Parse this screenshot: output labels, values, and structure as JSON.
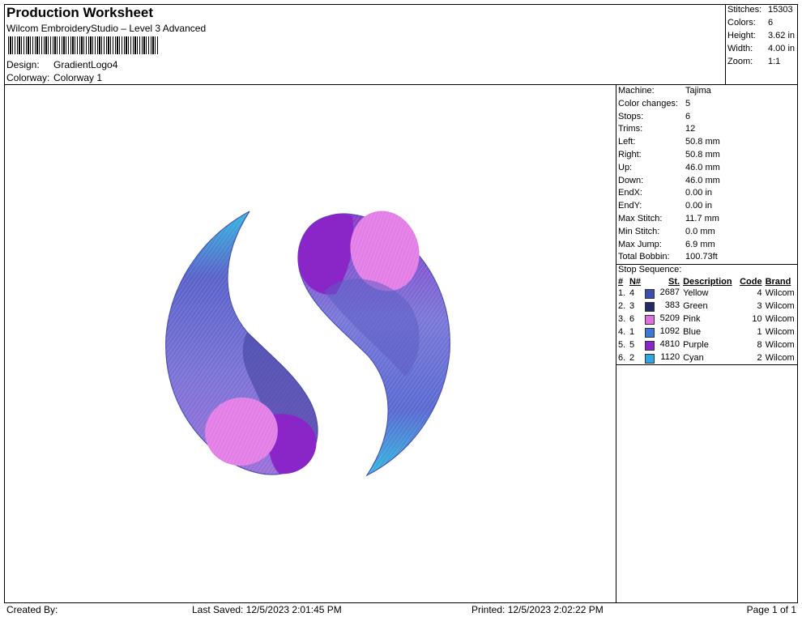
{
  "header": {
    "title": "Production Worksheet",
    "software": "Wilcom EmbroideryStudio – Level 3 Advanced",
    "design_label": "Design:",
    "design_value": "GradientLogo4",
    "colorway_label": "Colorway:",
    "colorway_value": "Colorway 1"
  },
  "summary": {
    "stitches_label": "Stitches:",
    "stitches_value": "15303",
    "colors_label": "Colors:",
    "colors_value": "6",
    "height_label": "Height:",
    "height_value": "3.62 in",
    "width_label": "Width:",
    "width_value": "4.00 in",
    "zoom_label": "Zoom:",
    "zoom_value": "1:1"
  },
  "details": [
    {
      "label": "Machine:",
      "value": "Tajima"
    },
    {
      "label": "Color changes:",
      "value": "5"
    },
    {
      "label": "Stops:",
      "value": "6"
    },
    {
      "label": "Trims:",
      "value": "12"
    },
    {
      "label": "Left:",
      "value": "50.8 mm"
    },
    {
      "label": "Right:",
      "value": "50.8 mm"
    },
    {
      "label": "Up:",
      "value": "46.0 mm"
    },
    {
      "label": "Down:",
      "value": "46.0 mm"
    },
    {
      "label": "EndX:",
      "value": "0.00 in"
    },
    {
      "label": "EndY:",
      "value": "0.00 in"
    },
    {
      "label": "Max Stitch:",
      "value": "11.7 mm"
    },
    {
      "label": "Min Stitch:",
      "value": "0.0 mm"
    },
    {
      "label": "Max Jump:",
      "value": "6.9 mm"
    },
    {
      "label": "Total Bobbin:",
      "value": "100.73ft"
    }
  ],
  "stop_sequence": {
    "title": "Stop Sequence:",
    "headers": {
      "num": "#",
      "n": "N#",
      "st": "St.",
      "desc": "Description",
      "code": "Code",
      "brand": "Brand"
    },
    "rows": [
      {
        "num": "1.",
        "n": "4",
        "color": "#3a4fb0",
        "st": "2687",
        "desc": "Yellow",
        "code": "4",
        "brand": "Wilcom"
      },
      {
        "num": "2.",
        "n": "3",
        "color": "#262a66",
        "st": "383",
        "desc": "Green",
        "code": "3",
        "brand": "Wilcom"
      },
      {
        "num": "3.",
        "n": "6",
        "color": "#e070e0",
        "st": "5209",
        "desc": "Pink",
        "code": "10",
        "brand": "Wilcom"
      },
      {
        "num": "4.",
        "n": "1",
        "color": "#3b78d8",
        "st": "1092",
        "desc": "Blue",
        "code": "1",
        "brand": "Wilcom"
      },
      {
        "num": "5.",
        "n": "5",
        "color": "#8a25c8",
        "st": "4810",
        "desc": "Purple",
        "code": "8",
        "brand": "Wilcom"
      },
      {
        "num": "6.",
        "n": "2",
        "color": "#2fa6e6",
        "st": "1120",
        "desc": "Cyan",
        "code": "2",
        "brand": "Wilcom"
      }
    ]
  },
  "footer": {
    "created_by": "Created By:",
    "last_saved": "Last Saved: 12/5/2023 2:01:45 PM",
    "printed": "Printed: 12/5/2023 2:02:22 PM",
    "page": "Page 1 of 1"
  }
}
